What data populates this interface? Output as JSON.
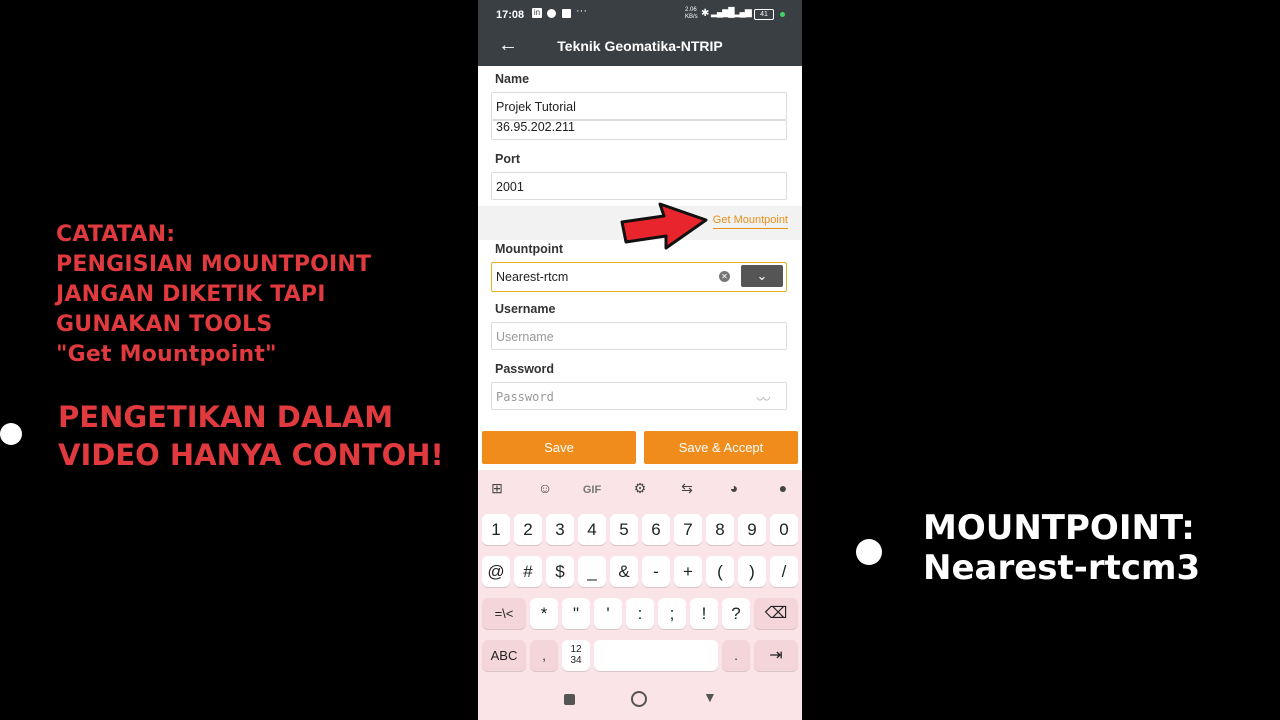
{
  "notes": {
    "small": [
      "CATATAN:",
      "PENGISIAN MOUNTPOINT",
      "JANGAN DIKETIK TAPI",
      "GUNAKAN TOOLS",
      "\"Get Mountpoint\""
    ],
    "big": [
      "PENGETIKAN DALAM",
      "VIDEO HANYA CONTOH!"
    ],
    "right": [
      "MOUNTPOINT:",
      "Nearest-rtcm3"
    ]
  },
  "status": {
    "time": "17:08",
    "dots": "···",
    "speed": "2.06 KB/s",
    "battery": "41"
  },
  "appbar": {
    "title": "Teknik Geomatika-NTRIP"
  },
  "form": {
    "name_label": "Name",
    "name_value": "Projek Tutorial",
    "address_value": "36.95.202.211",
    "port_label": "Port",
    "port_value": "2001",
    "get_mountpoint": "Get Mountpoint",
    "mountpoint_label": "Mountpoint",
    "mountpoint_value": "Nearest-rtcm",
    "username_label": "Username",
    "username_placeholder": "Username",
    "password_label": "Password",
    "password_placeholder": "Password"
  },
  "buttons": {
    "save": "Save",
    "save_accept": "Save & Accept"
  },
  "keyboard": {
    "toolbar": [
      "grid-icon",
      "sticker-icon",
      "gif-icon",
      "gear-icon",
      "translate-icon",
      "palette-icon",
      "mic-icon"
    ],
    "gif_label": "GIF",
    "row1": [
      "1",
      "2",
      "3",
      "4",
      "5",
      "6",
      "7",
      "8",
      "9",
      "0"
    ],
    "row2": [
      "@",
      "#",
      "$",
      "_",
      "&",
      "-",
      "+",
      "(",
      ")",
      "/"
    ],
    "row3": [
      "=\\<",
      "*",
      "\"",
      "'",
      ":",
      ";",
      "!",
      "?"
    ],
    "row4": {
      "abc": "ABC",
      "comma": ",",
      "num": "12\n34",
      "dot": "."
    }
  },
  "colors": {
    "accent": "#ef8c1c",
    "appbar": "#3a3f44",
    "note_red": "#e03a3f",
    "keyboard_bg": "#fbe4e7"
  }
}
